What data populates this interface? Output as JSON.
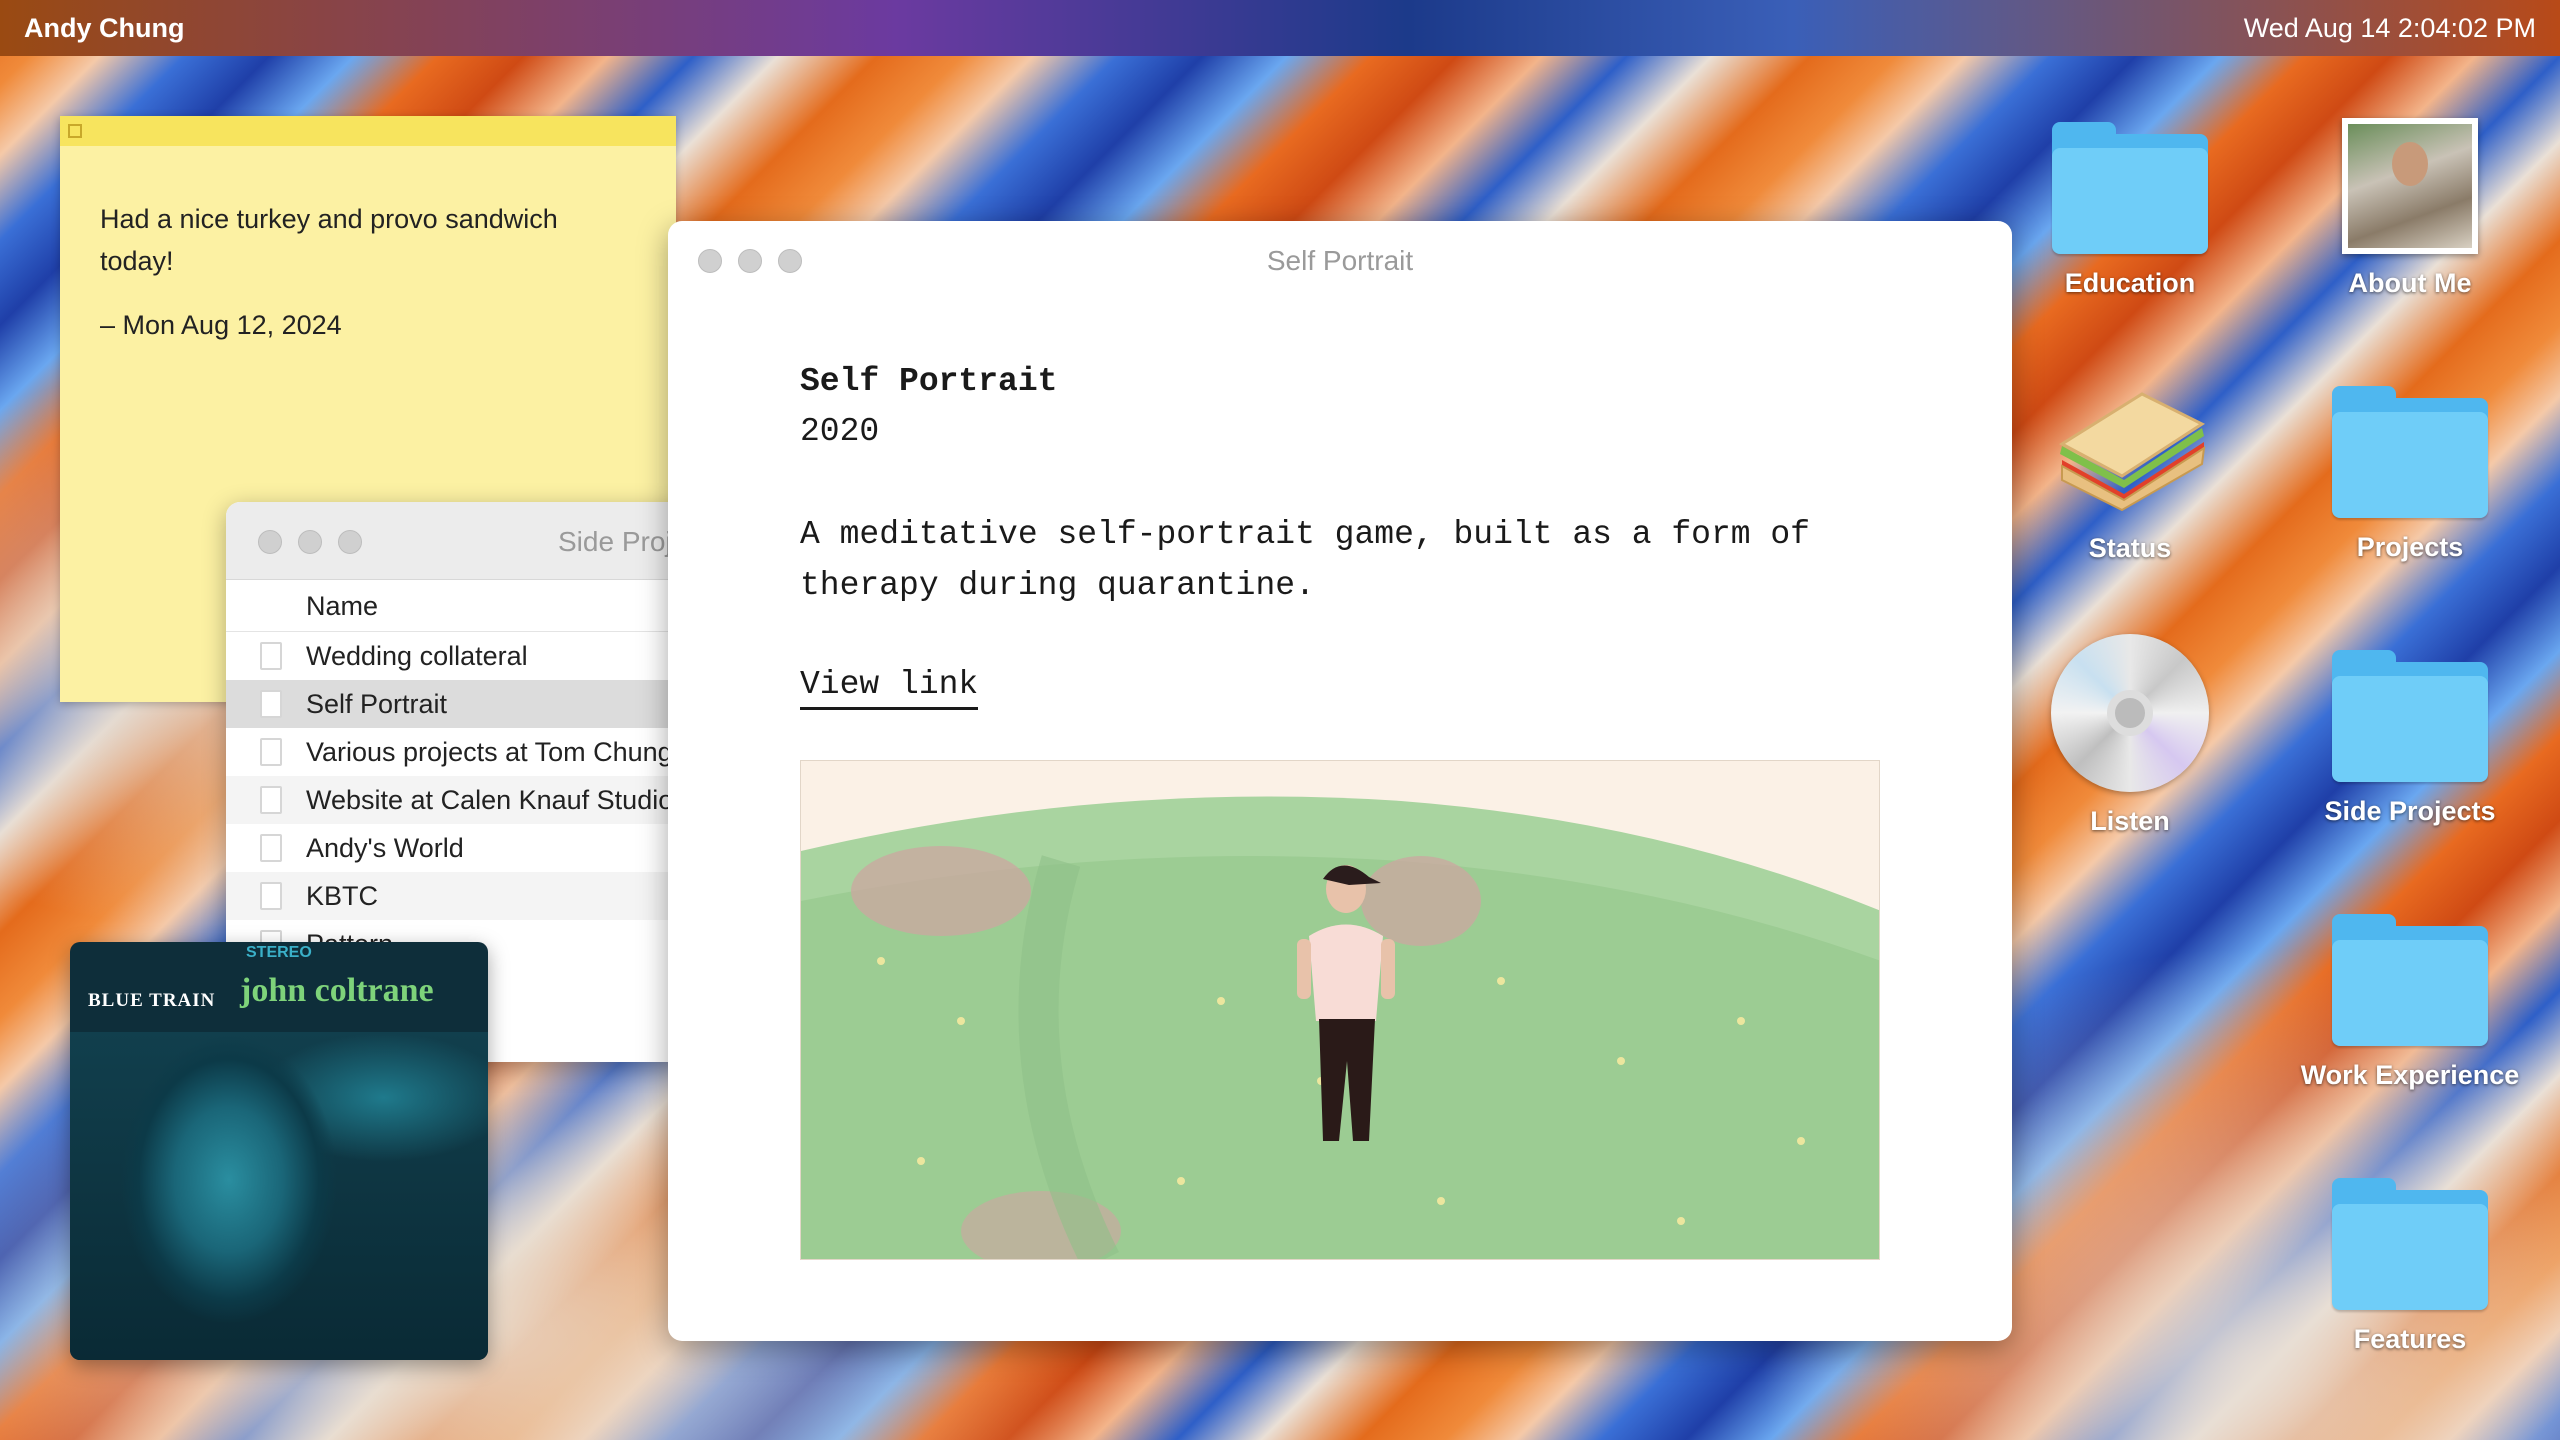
{
  "menubar": {
    "owner": "Andy Chung",
    "clock": "Wed Aug 14  2:04:02 PM"
  },
  "sticky": {
    "text": "Had a nice turkey and provo sandwich today!",
    "signature": "– Mon Aug 12, 2024"
  },
  "side_window": {
    "title": "Side Projects",
    "column": "Name",
    "rows": [
      "Wedding collateral",
      "Self Portrait",
      "Various projects at Tom Chung",
      "Website at Calen Knauf Studio",
      "Andy's World",
      "KBTC",
      "Pattern"
    ],
    "selected_row": "Self Portrait"
  },
  "album": {
    "stereo": "STEREO",
    "title": "BLUE TRAIN",
    "artist": "john coltrane"
  },
  "main_window": {
    "title": "Self Portrait",
    "heading": "Self Portrait",
    "year": "2020",
    "description": "A meditative self-portrait game, built as a form of therapy during quarantine.",
    "link": "View link"
  },
  "desktop_icons": [
    {
      "label": "Education",
      "icon": "folder-icon"
    },
    {
      "label": "About Me",
      "icon": "photo-icon"
    },
    {
      "label": "Status",
      "icon": "sandwich-icon"
    },
    {
      "label": "Projects",
      "icon": "folder-icon"
    },
    {
      "label": "Listen",
      "icon": "cd-icon"
    },
    {
      "label": "Side Projects",
      "icon": "folder-icon"
    },
    {
      "label": "Work Experience",
      "icon": "folder-icon"
    },
    {
      "label": "Features",
      "icon": "folder-icon"
    }
  ]
}
